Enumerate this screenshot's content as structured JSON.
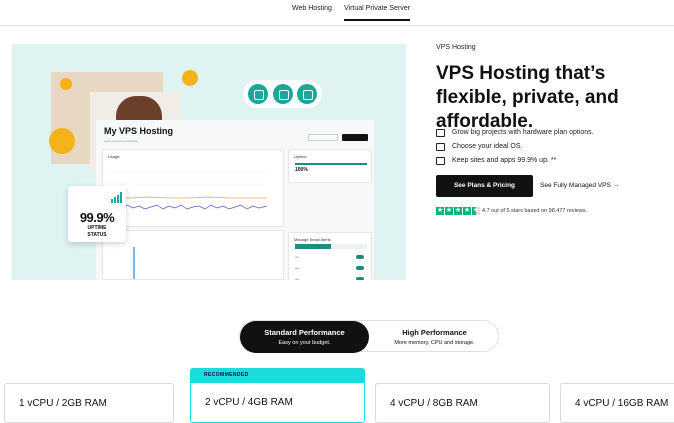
{
  "topnav": {
    "tabs": [
      "Web Hosting",
      "Virtual Private Server"
    ],
    "active": "Virtual Private Server"
  },
  "hero_image": {
    "dashboard_title": "My VPS Hosting",
    "usage_label": "Usage",
    "uptime_label": "Uptime",
    "uptime_value": "100%",
    "email_alerts_label": "Manage Email Alerts",
    "badge": {
      "value": "99.9%",
      "line1": "UPTIME",
      "line2": "STATUS"
    },
    "colors": {
      "accent": "#18a999",
      "background": "#dff3f3"
    }
  },
  "hero": {
    "eyebrow": "VPS Hosting",
    "headline": "VPS Hosting that’s flexible, private, and affordable.",
    "features": [
      {
        "icon": "server-icon",
        "text": "Grow big projects with hardware plan options."
      },
      {
        "icon": "stack-icon",
        "text": "Choose your ideal OS."
      },
      {
        "icon": "storage-icon",
        "text": "Keep sites and apps 99.9% up. **"
      }
    ],
    "cta_primary": "See Plans & Pricing",
    "cta_secondary": "See Fully Managed VPS →",
    "rating_text": "4.7 out of 5 stars based on 98,477 reviews.",
    "stars": 4.5
  },
  "performance_toggle": {
    "options": [
      {
        "title": "Standard Performance",
        "subtitle": "Easy on your budget.",
        "active": true
      },
      {
        "title": "High Performance",
        "subtitle": "More memory, CPU and storage.",
        "active": false
      }
    ]
  },
  "plans": {
    "recommended_label": "RECOMMENDED",
    "items": [
      "1 vCPU / 2GB RAM",
      "2 vCPU / 4GB RAM",
      "4 vCPU / 8GB RAM",
      "4 vCPU / 16GB RAM"
    ]
  }
}
